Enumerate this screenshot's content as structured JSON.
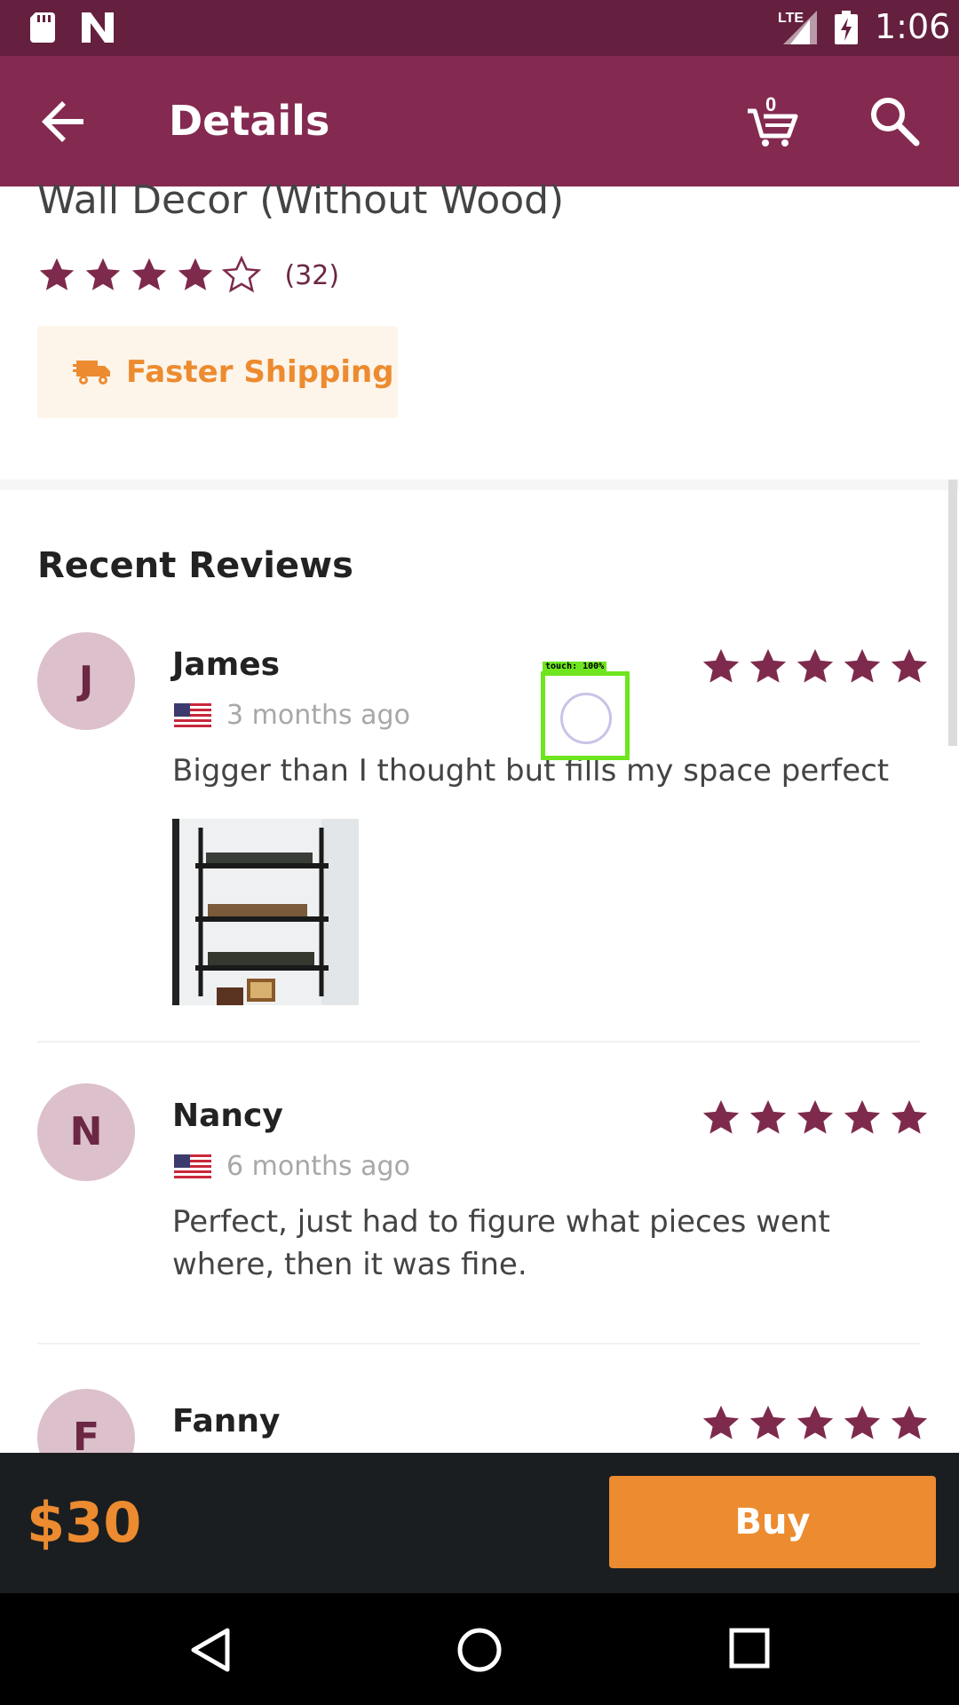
{
  "status_bar": {
    "network": "LTE",
    "time": "1:06"
  },
  "app_bar": {
    "title": "Details",
    "cart_count": "0"
  },
  "product": {
    "title": "Wall Decor (Without Wood)",
    "rating": 4,
    "rating_count": "(32)",
    "shipping_label": "Faster Shipping"
  },
  "reviews_section": {
    "title": "Recent Reviews",
    "reviews": [
      {
        "initial": "J",
        "name": "James",
        "date": "3 months ago",
        "stars": 5,
        "text": "Bigger than I thought but fills my space perfect",
        "has_photo": true
      },
      {
        "initial": "N",
        "name": "Nancy",
        "date": "6 months ago",
        "stars": 5,
        "text": "Perfect, just had to figure what pieces went where, then it was fine.",
        "has_photo": false
      },
      {
        "initial": "F",
        "name": "Fanny",
        "stars": 5
      }
    ]
  },
  "touch_overlay": {
    "label": "touch: 100%"
  },
  "buy_bar": {
    "price": "$30",
    "buy_label": "Buy"
  },
  "colors": {
    "status_bar": "#651f3f",
    "app_bar": "#842a51",
    "accent_orange": "#ec8b2f",
    "star": "#7e2a4d",
    "avatar_bg": "#dcc0cb"
  }
}
